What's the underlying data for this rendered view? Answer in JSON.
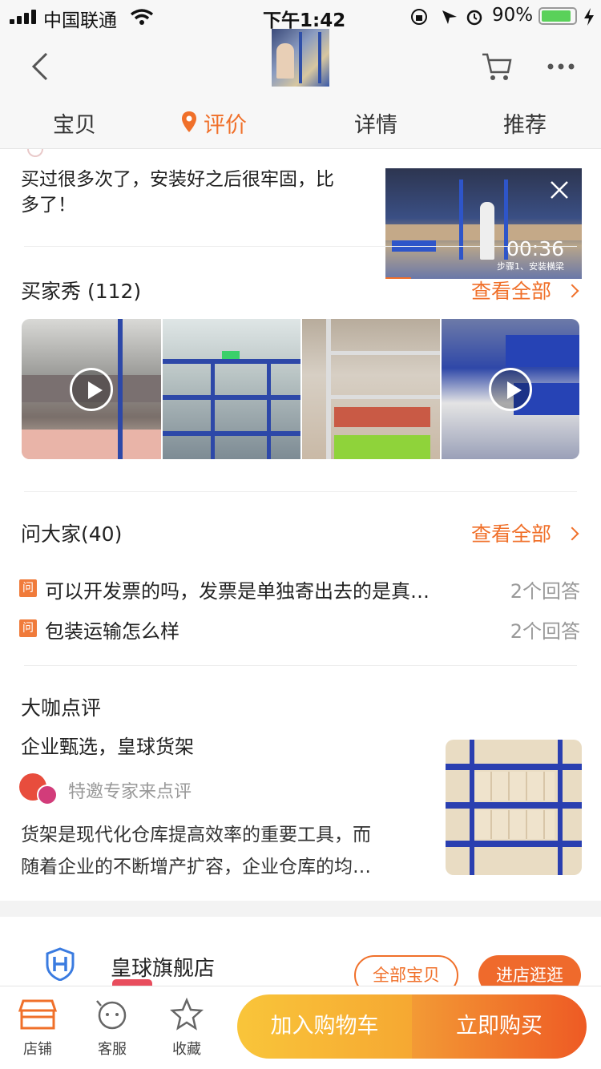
{
  "status": {
    "carrier": "中国联通",
    "time": "下午1:42",
    "battery": "90%"
  },
  "nav": {
    "tabs": [
      "宝贝",
      "评价",
      "详情",
      "推荐"
    ]
  },
  "review": {
    "text_line1": "买过很多次了，安装好之后很牢固，比",
    "text_line2": "多了！"
  },
  "video": {
    "duration": "00:36",
    "caption": "步骤1、安装横梁"
  },
  "buyer_show": {
    "title": "买家秀 (112)",
    "view_all": "查看全部"
  },
  "qa": {
    "title": "问大家(40)",
    "view_all": "查看全部",
    "tag": "问",
    "items": [
      {
        "q": "可以开发票的吗，发票是单独寄出去的是真…",
        "a": "2个回答"
      },
      {
        "q": "包装运输怎么样",
        "a": "2个回答"
      }
    ]
  },
  "expert": {
    "title": "大咖点评",
    "headline": "企业甄选，皇球货架",
    "badge": "特邀专家来点评",
    "body_line1": "货架是现代化仓库提高效率的重要工具，而",
    "body_line2": "随着企业的不断增产扩容，企业仓库的均…"
  },
  "shop": {
    "name": "皇球旗舰店",
    "all_items": "全部宝贝",
    "enter": "进店逛逛"
  },
  "bottom": {
    "store": "店铺",
    "service": "客服",
    "fav": "收藏",
    "add_cart": "加入购物车",
    "buy_now": "立即购买"
  },
  "colors": {
    "accent": "#f0702a",
    "cart_gradient_start": "#f9c53a",
    "buy_gradient_end": "#ee5a24"
  }
}
